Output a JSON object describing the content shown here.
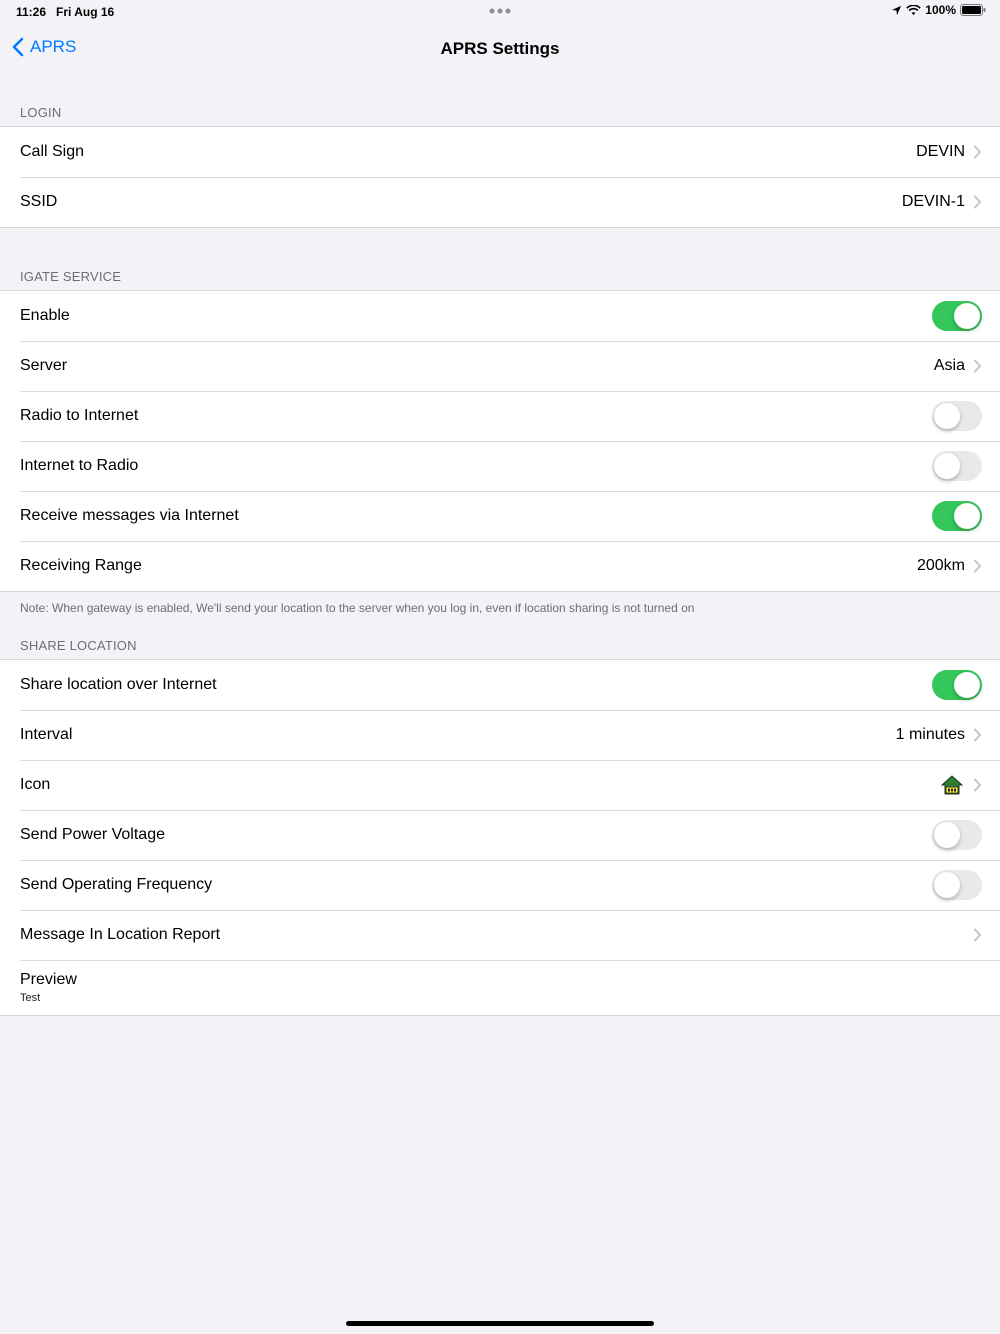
{
  "status": {
    "time": "11:26",
    "date": "Fri Aug 16",
    "battery": "100%"
  },
  "nav": {
    "back_label": "APRS",
    "title": "APRS Settings"
  },
  "login": {
    "header": "LOGIN",
    "rows": [
      {
        "label": "Call Sign",
        "value": "DEVIN"
      },
      {
        "label": "SSID",
        "value": "DEVIN-1"
      }
    ]
  },
  "igate": {
    "header": "IGATE SERVICE",
    "enable": {
      "label": "Enable",
      "on": true
    },
    "server": {
      "label": "Server",
      "value": "Asia"
    },
    "radio_to_internet": {
      "label": "Radio to Internet",
      "on": false
    },
    "internet_to_radio": {
      "label": "Internet to Radio",
      "on": false
    },
    "receive_messages": {
      "label": "Receive messages via Internet",
      "on": true
    },
    "receiving_range": {
      "label": "Receiving Range",
      "value": "200km"
    },
    "note": "Note: When gateway is enabled, We'll send your location to the server when you log in, even if location sharing is not turned on"
  },
  "share": {
    "header": "SHARE LOCATION",
    "share_location": {
      "label": "Share location over Internet",
      "on": true
    },
    "interval": {
      "label": "Interval",
      "value": "1 minutes"
    },
    "icon": {
      "label": "Icon",
      "icon_name": "house-icon"
    },
    "power_voltage": {
      "label": "Send Power Voltage",
      "on": false
    },
    "operating_frequency": {
      "label": "Send Operating Frequency",
      "on": false
    },
    "message": {
      "label": "Message In Location Report"
    },
    "preview": {
      "label": "Preview",
      "sub": "Test"
    }
  },
  "colors": {
    "accent": "#007aff",
    "toggle_on": "#34c759",
    "toggle_off": "#e9e9ea",
    "background": "#f2f2f7"
  }
}
